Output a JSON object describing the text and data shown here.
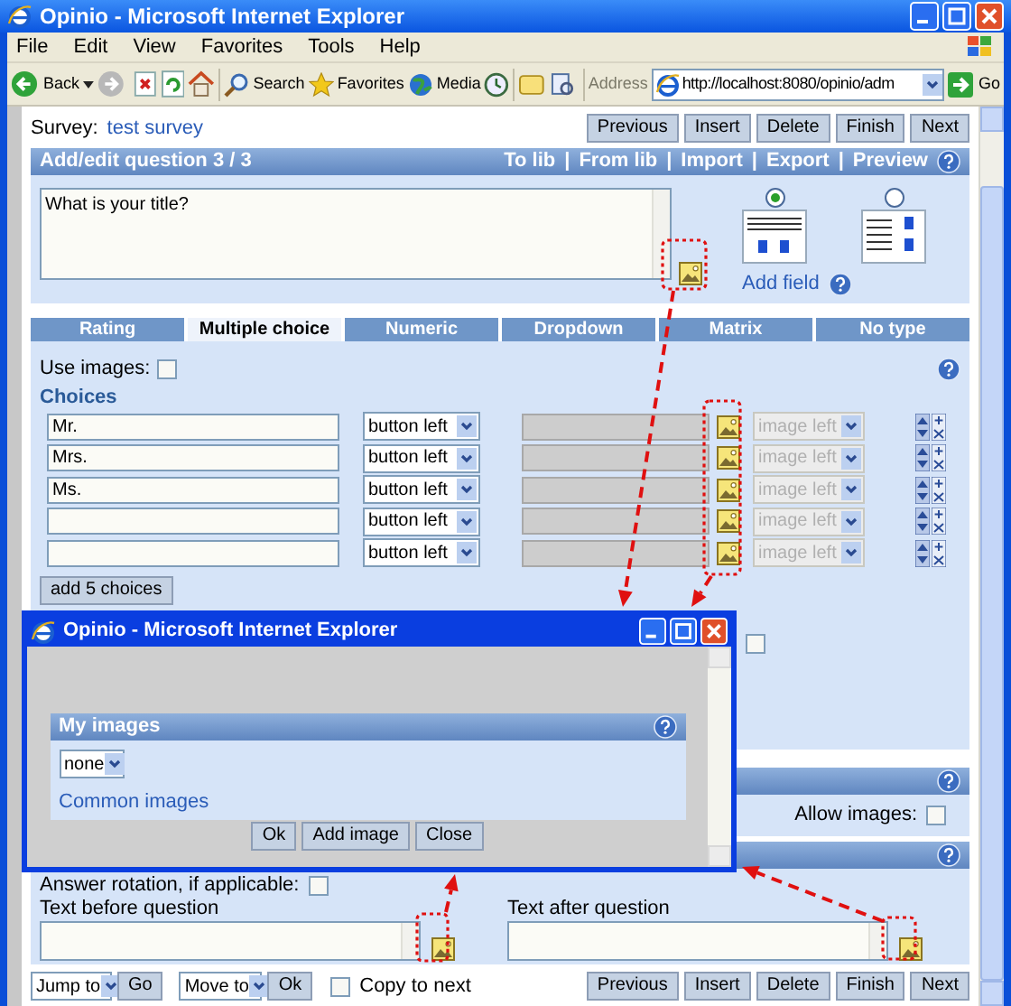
{
  "window": {
    "title": "Opinio - Microsoft Internet Explorer"
  },
  "menu": [
    "File",
    "Edit",
    "View",
    "Favorites",
    "Tools",
    "Help"
  ],
  "toolbar": {
    "back": "Back",
    "search": "Search",
    "favorites": "Favorites",
    "media": "Media",
    "address_label": "Address",
    "address": "http://localhost:8080/opinio/adm",
    "go": "Go"
  },
  "survey": {
    "label": "Survey:",
    "name": "test survey"
  },
  "nav_buttons_top": [
    "Previous",
    "Insert",
    "Delete",
    "Finish",
    "Next"
  ],
  "question_header": {
    "title": "Add/edit question 3 / 3",
    "separator": "|",
    "links": [
      "To lib",
      "From lib",
      "Import",
      "Export",
      "Preview"
    ]
  },
  "question_text": "What is your title?",
  "layouts": [
    {
      "kind": "horizontal",
      "selected": true
    },
    {
      "kind": "vertical",
      "selected": false
    }
  ],
  "add_field": "Add field",
  "type_tabs": [
    {
      "label": "Rating",
      "selected": false
    },
    {
      "label": "Multiple choice",
      "selected": true
    },
    {
      "label": "Numeric",
      "selected": false
    },
    {
      "label": "Dropdown",
      "selected": false
    },
    {
      "label": "Matrix",
      "selected": false
    },
    {
      "label": "No type",
      "selected": false
    }
  ],
  "use_images": {
    "label": "Use images:",
    "checked": false
  },
  "choices_heading": "Choices",
  "choices": [
    {
      "text": "Mr.",
      "position": "button left",
      "image_position": "image left"
    },
    {
      "text": "Mrs.",
      "position": "button left",
      "image_position": "image left"
    },
    {
      "text": "Ms.",
      "position": "button left",
      "image_position": "image left"
    },
    {
      "position": "button left",
      "image_position": "image left"
    },
    {
      "position": "button left",
      "image_position": "image left"
    }
  ],
  "add_choices": "add 5 choices",
  "partly_hidden_checkbox": {
    "checked": false
  },
  "allow_images": {
    "label": "Allow images:",
    "checked": false
  },
  "popup": {
    "title": "Opinio - Microsoft Internet Explorer",
    "section": "My images",
    "select": "none",
    "link": "Common images",
    "buttons": [
      "Ok",
      "Add image",
      "Close"
    ]
  },
  "answer_rotation": {
    "label": "Answer rotation, if applicable:",
    "checked": false
  },
  "text_before": {
    "label": "Text before question"
  },
  "text_after": {
    "label": "Text after question"
  },
  "bottom": {
    "jump": "Jump to",
    "go": "Go",
    "move": "Move to",
    "ok": "Ok",
    "copy": {
      "label": "Copy to next",
      "checked": false
    },
    "buttons": [
      "Previous",
      "Insert",
      "Delete",
      "Finish",
      "Next"
    ]
  }
}
